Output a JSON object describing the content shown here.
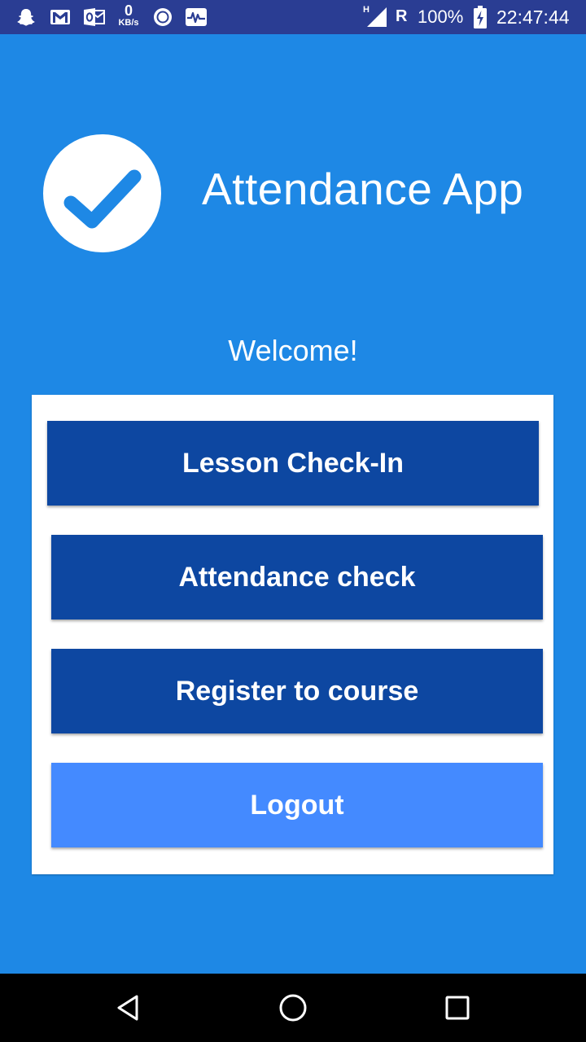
{
  "status_bar": {
    "data_rate_value": "0",
    "data_rate_unit": "KB/s",
    "network_type": "H",
    "roaming": "R",
    "battery": "100%",
    "time": "22:47:44",
    "icons": [
      "snapchat-icon",
      "gmail-icon",
      "outlook-icon",
      "data-rate-icon",
      "circle-app-icon",
      "activity-icon",
      "signal-icon",
      "battery-charging-icon"
    ]
  },
  "header": {
    "logo_icon": "checkmark-icon",
    "title": "Attendance App"
  },
  "welcome": "Welcome!",
  "menu": {
    "lesson_checkin": "Lesson Check-In",
    "attendance_check": "Attendance check",
    "register_course": "Register to course",
    "logout": "Logout"
  },
  "nav_bar": {
    "icons": [
      "back-icon",
      "home-icon",
      "recents-icon"
    ]
  },
  "colors": {
    "background": "#1E88E5",
    "status_bar": "#2A3D93",
    "button_primary": "#0D47A1",
    "button_logout": "#448AFF",
    "card": "#FFFFFF",
    "checkmark": "#1E88E5"
  }
}
